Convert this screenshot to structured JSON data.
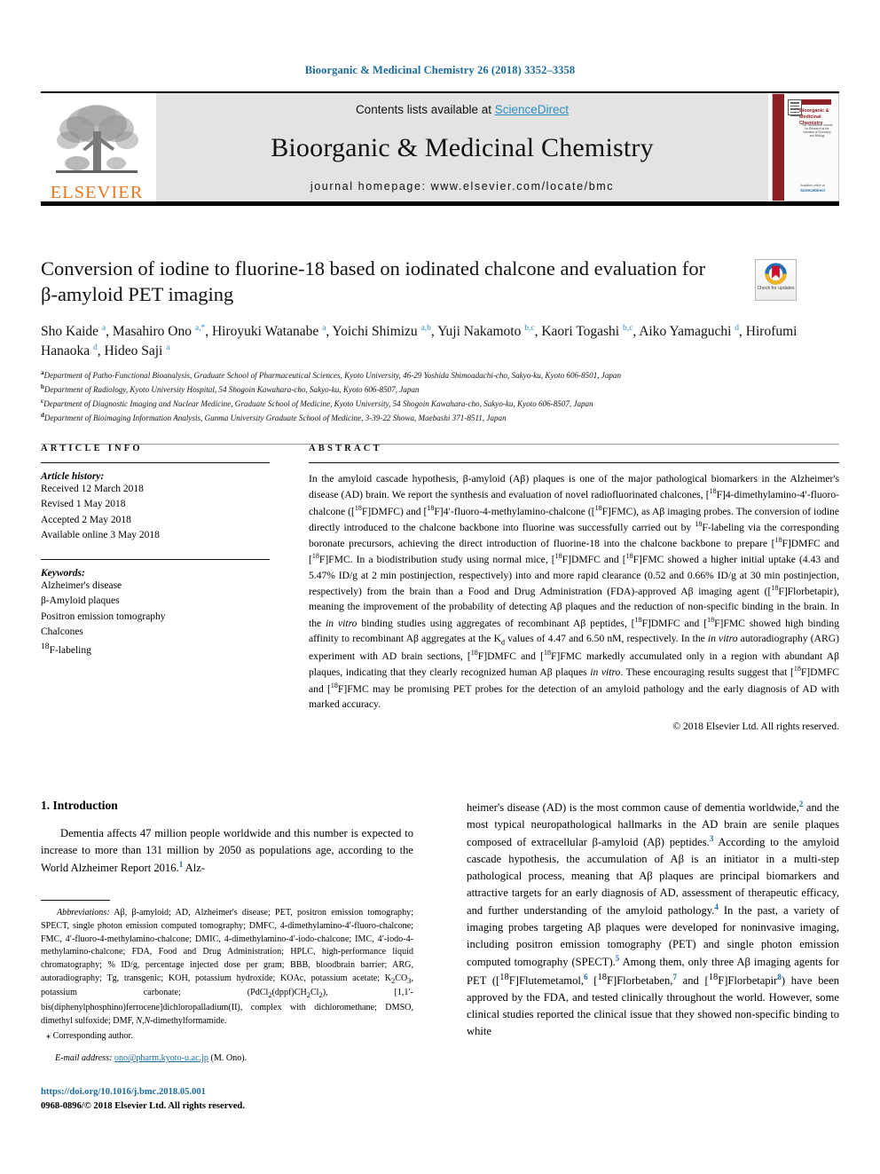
{
  "running_head": "Bioorganic & Medicinal Chemistry 26 (2018) 3352–3358",
  "masthead": {
    "contents_prefix": "Contents lists available at ",
    "sciencedirect": "ScienceDirect",
    "journal_title": "Bioorganic & Medicinal Chemistry",
    "homepage": "journal homepage: www.elsevier.com/locate/bmc",
    "publisher": "ELSEVIER",
    "cover": {
      "title": "Bioorganic & Medicinal Chemistry",
      "subtitle": "The Tetrahedron Journal for Research at the Interface of Chemistry and Biology",
      "bottom_label": "Available online at",
      "bottom_brand": "ScienceDirect"
    }
  },
  "article": {
    "title": "Conversion of iodine to fluorine-18 based on iodinated chalcone and evaluation for β-amyloid PET imaging",
    "crossmark_label": "Check for updates",
    "authors_html": "Sho Kaide <sup>a</sup>, Masahiro Ono <sup>a,*</sup>, Hiroyuki Watanabe <sup>a</sup>, Yoichi Shimizu <sup>a,b</sup>, Yuji Nakamoto <sup>b,c</sup>, Kaori Togashi <sup>b,c</sup>, Aiko Yamaguchi <sup>d</sup>, Hirofumi Hanaoka <sup>d</sup>, Hideo Saji <sup>a</sup>",
    "affiliations": [
      {
        "marker": "a",
        "text": "Department of Patho-Functional Bioanalysis, Graduate School of Pharmaceutical Sciences, Kyoto University, 46-29 Yoshida Shimoadachi-cho, Sakyo-ku, Kyoto 606-8501, Japan"
      },
      {
        "marker": "b",
        "text": "Department of Radiology, Kyoto University Hospital, 54 Shogoin Kawahara-cho, Sakyo-ku, Kyoto 606-8507, Japan"
      },
      {
        "marker": "c",
        "text": "Department of Diagnostic Imaging and Nuclear Medicine, Graduate School of Medicine, Kyoto University, 54 Shogoin Kawahara-cho, Sakyo-ku, Kyoto 606-8507, Japan"
      },
      {
        "marker": "d",
        "text": "Department of Bioimaging Information Analysis, Gunma University Graduate School of Medicine, 3-39-22 Showa, Maebashi 371-8511, Japan"
      }
    ]
  },
  "article_info": {
    "label": "ARTICLE INFO",
    "history_label": "Article history:",
    "history": [
      "Received 12 March 2018",
      "Revised 1 May 2018",
      "Accepted 2 May 2018",
      "Available online 3 May 2018"
    ],
    "keywords_label": "Keywords:",
    "keywords_html": [
      "Alzheimer's disease",
      "β-Amyloid plaques",
      "Positron emission tomography",
      "Chalcones",
      "<sup>18</sup>F-labeling"
    ]
  },
  "abstract": {
    "label": "ABSTRACT",
    "body_html": "In the amyloid cascade hypothesis, β-amyloid (Aβ) plaques is one of the major pathological biomarkers in the Alzheimer's disease (AD) brain. We report the synthesis and evaluation of novel radiofluorinated chalcones, [<sup>18</sup>F]4-dimethylamino-4′-fluoro-chalcone ([<sup>18</sup>F]DMFC) and [<sup>18</sup>F]4′-fluoro-4-methylamino-chalcone ([<sup>18</sup>F]FMC), as Aβ imaging probes. The conversion of iodine directly introduced to the chalcone backbone into fluorine was successfully carried out by <sup>18</sup>F-labeling via the corresponding boronate precursors, achieving the direct introduction of fluorine-18 into the chalcone backbone to prepare [<sup>18</sup>F]DMFC and [<sup>18</sup>F]FMC. In a biodistribution study using normal mice, [<sup>18</sup>F]DMFC and [<sup>18</sup>F]FMC showed a higher initial uptake (4.43 and 5.47% ID/g at 2 min postinjection, respectively) into and more rapid clearance (0.52 and 0.66% ID/g at 30 min postinjection, respectively) from the brain than a Food and Drug Administration (FDA)-approved Aβ imaging agent ([<sup>18</sup>F]Florbetapir), meaning the improvement of the probability of detecting Aβ plaques and the reduction of non-specific binding in the brain. In the <i>in vitro</i> binding studies using aggregates of recombinant Aβ peptides, [<sup>18</sup>F]DMFC and [<sup>18</sup>F]FMC showed high binding affinity to recombinant Aβ aggregates at the K<sub>d</sub> values of 4.47 and 6.50 nM, respectively. In the <i>in vitro</i> autoradiography (ARG) experiment with AD brain sections, [<sup>18</sup>F]DMFC and [<sup>18</sup>F]FMC markedly accumulated only in a region with abundant Aβ plaques, indicating that they clearly recognized human Aβ plaques <i>in vitro</i>. These encouraging results suggest that [<sup>18</sup>F]DMFC and [<sup>18</sup>F]FMC may be promising PET probes for the detection of an amyloid pathology and the early diagnosis of AD with marked accuracy.",
    "copyright": "© 2018 Elsevier Ltd. All rights reserved."
  },
  "intro": {
    "heading": "1. Introduction",
    "left_para_html": "Dementia affects 47 million people worldwide and this number is expected to increase to more than 131 million by 2050 as populations age, according to the World Alzheimer Report 2016.<span class=\"ref\">1</span> Alz-",
    "right_para_html": "heimer's disease (AD) is the most common cause of dementia worldwide,<span class=\"ref\">2</span> and the most typical neuropathological hallmarks in the AD brain are senile plaques composed of extracellular β-amyloid (Aβ) peptides.<span class=\"ref\">3</span> According to the amyloid cascade hypothesis, the accumulation of Aβ is an initiator in a multi-step pathological process, meaning that Aβ plaques are principal biomarkers and attractive targets for an early diagnosis of AD, assessment of therapeutic efficacy, and further understanding of the amyloid pathology.<span class=\"ref\">4</span> In the past, a variety of imaging probes targeting Aβ plaques were developed for noninvasive imaging, including positron emission tomography (PET) and single photon emission computed tomography (SPECT).<span class=\"ref\">5</span> Among them, only three Aβ imaging agents for PET ([<sup>18</sup>F]Flutemetamol,<span class=\"ref\">6</span> [<sup>18</sup>F]Florbetaben,<span class=\"ref\">7</span> and [<sup>18</sup>F]Florbetapir<span class=\"ref\">8</span>) have been approved by the FDA, and tested clinically throughout the world. However, some clinical studies reported the clinical issue that they showed non-specific binding to white"
  },
  "footnote": {
    "abbreviations_html": "<i>Abbreviations:</i> Aβ, β-amyloid; AD, Alzheimer's disease; PET, positron emission tomography; SPECT, single photon emission computed tomography; DMFC, 4-dimethylamino-4′-fluoro-chalcone; FMC, 4′-fluoro-4-methylamino-chalcone; DMIC, 4-dimethylamino-4′-iodo-chalcone; IMC, 4′-iodo-4-methylamino-chalcone; FDA, Food and Drug Administration; HPLC, high-performance liquid chromatography; % ID/g, percentage injected dose per gram; BBB, bloodbrain barrier; ARG, autoradiography; Tg, transgenic; KOH, potassium hydroxide; KOAc, potassium acetate; K<sub>2</sub>CO<sub>3</sub>, potassium carbonate; (PdCl<sub>2</sub>(dppf)CH<sub>2</sub>Cl<sub>2</sub>), [1,1′-bis(diphenylphosphino)ferrocene]dichloropalladium(II), complex with dichloromethane; DMSO, dimethyl sulfoxide; DMF, <i>N,N</i>-dimethylformamide.",
    "corresponding": "⁎ Corresponding author.",
    "email_label": "E-mail address:",
    "email": "ono@pharm.kyoto-u.ac.jp",
    "email_suffix": "(M. Ono).",
    "doi": "https://doi.org/10.1016/j.bmc.2018.05.001",
    "issn_line": "0968-0896/© 2018 Elsevier Ltd. All rights reserved."
  }
}
